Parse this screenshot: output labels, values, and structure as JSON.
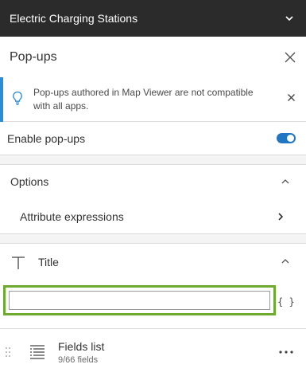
{
  "layer": {
    "title": "Electric Charging Stations",
    "chevron_icon": "chevron-down-icon"
  },
  "panel": {
    "title": "Pop-ups",
    "close_icon": "close-icon"
  },
  "notice": {
    "message": "Pop-ups authored in Map Viewer are not compatible with all apps.",
    "icon": "lightbulb-icon",
    "accent_color": "#2b8cd8"
  },
  "enable_popups": {
    "label": "Enable pop-ups",
    "on": true,
    "color": "#2176c4"
  },
  "options": {
    "label": "Options",
    "expanded": true,
    "items": [
      {
        "label": "Attribute expressions"
      }
    ]
  },
  "title_section": {
    "label": "Title",
    "expanded": true,
    "input_value": "",
    "expression_button": "{ }",
    "highlight_color": "#6eaa2f"
  },
  "fields_list": {
    "label": "Fields list",
    "count": "9/66 fields"
  }
}
